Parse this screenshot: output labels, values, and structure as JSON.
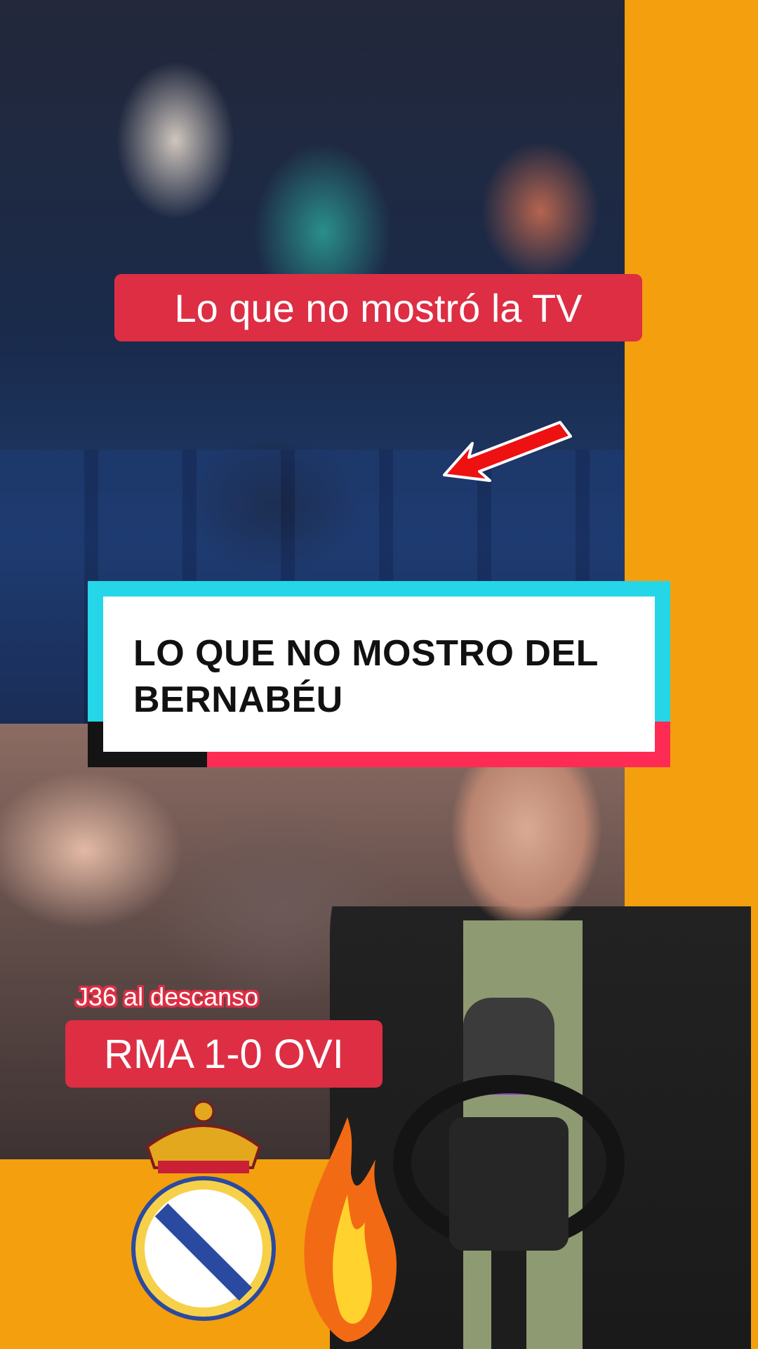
{
  "overlay": {
    "top_label": "Lo que no mostró la TV",
    "title_lines": [
      "LO QUE NO MOSTRO DEL",
      "BERNABÉU"
    ],
    "matchday_label": "J36 al descanso",
    "score_label": "RMA 1-0 OVI"
  },
  "colors": {
    "background_orange": "#f49f0e",
    "label_red": "#dd2e44",
    "title_cyan": "#25d6e8",
    "title_pink": "#fe2c55"
  },
  "icons": {
    "pointer": "red-arrow-icon",
    "crest": "real-madrid-crest-icon",
    "fire": "fire-icon"
  }
}
